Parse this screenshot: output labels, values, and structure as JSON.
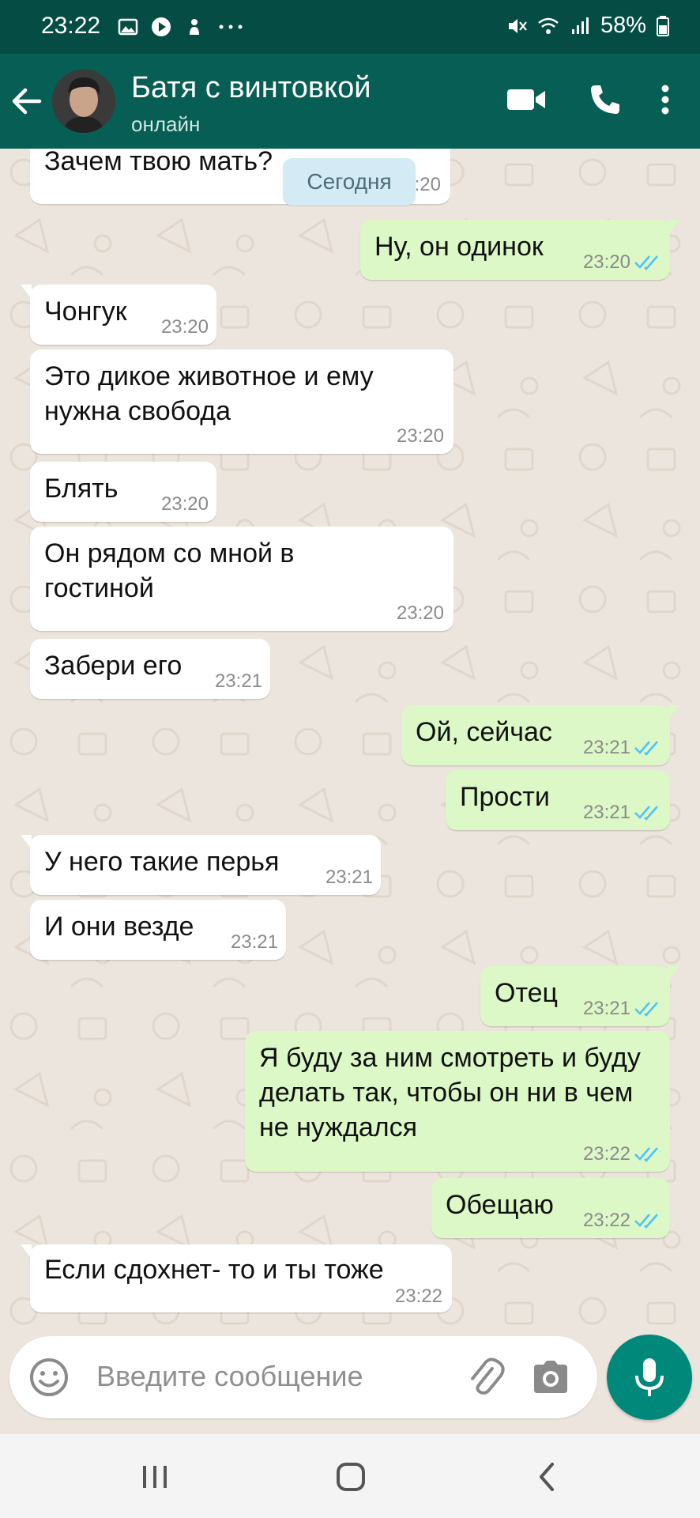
{
  "status_bar": {
    "time": "23:22",
    "battery": "58%",
    "left_icons": [
      "gallery-icon",
      "play-icon",
      "notification-icon",
      "more-dots-icon"
    ],
    "right_icons": [
      "mute-icon",
      "wifi-icon",
      "signal-icon",
      "battery-icon"
    ]
  },
  "header": {
    "contact_name": "Батя с винтовкой",
    "contact_status": "онлайн",
    "colors": {
      "bar": "#075e54",
      "status_bar": "#054d44"
    }
  },
  "chat": {
    "date_chip": "Сегодня",
    "messages": [
      {
        "direction": "in",
        "text": "Зачем твою мать?",
        "time": "23:20"
      },
      {
        "direction": "out",
        "text": "Ну, он одинок",
        "time": "23:20",
        "read": true
      },
      {
        "direction": "in",
        "text": "Чонгук",
        "time": "23:20"
      },
      {
        "direction": "in",
        "text": "Это дикое животное и ему нужна свобода",
        "time": "23:20"
      },
      {
        "direction": "in",
        "text": "Блять",
        "time": "23:20"
      },
      {
        "direction": "in",
        "text": "Он рядом со мной в гостиной",
        "time": "23:20"
      },
      {
        "direction": "in",
        "text": "Забери его",
        "time": "23:21"
      },
      {
        "direction": "out",
        "text": "Ой, сейчас",
        "time": "23:21",
        "read": true
      },
      {
        "direction": "out",
        "text": "Прости",
        "time": "23:21",
        "read": true
      },
      {
        "direction": "in",
        "text": "У него такие перья",
        "time": "23:21"
      },
      {
        "direction": "in",
        "text": "И они везде",
        "time": "23:21"
      },
      {
        "direction": "out",
        "text": "Отец",
        "time": "23:21",
        "read": true
      },
      {
        "direction": "out",
        "text": "Я буду за ним смотреть и буду делать так, чтобы он ни в чем не нуждался",
        "time": "23:22",
        "read": true
      },
      {
        "direction": "out",
        "text": "Обещаю",
        "time": "23:22",
        "read": true
      },
      {
        "direction": "in",
        "text": "Если сдохнет- то и ты тоже",
        "time": "23:22"
      }
    ],
    "colors": {
      "incoming": "#ffffff",
      "outgoing": "#dcf8c6",
      "read_ticks": "#4fc3f7",
      "background": "#ece5dd"
    }
  },
  "composer": {
    "placeholder": "Введите сообщение",
    "mic_color": "#00897b"
  },
  "nav": {
    "icons": [
      "recent-apps-icon",
      "home-icon",
      "back-icon"
    ]
  }
}
